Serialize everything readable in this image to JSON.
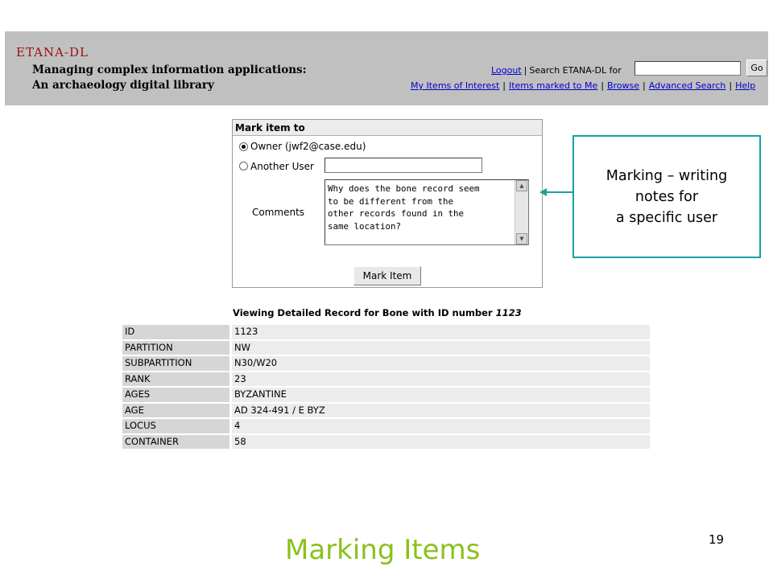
{
  "header": {
    "site_title": "ETANA-DL",
    "subtitle_line1": "Managing complex information applications:",
    "subtitle_line2": "An archaeology digital library",
    "logout_link": "Logout",
    "search_label": "Search ETANA-DL for",
    "search_value": "",
    "go_button": "Go",
    "nav": [
      "My Items of Interest",
      "Items marked to Me",
      "Browse",
      "Advanced Search",
      "Help"
    ]
  },
  "mark_form": {
    "heading": "Mark item to",
    "owner_option": "Owner (jwf2@case.edu)",
    "owner_checked": true,
    "another_user_option": "Another User",
    "another_user_checked": false,
    "another_user_value": "",
    "comments_label": "Comments",
    "comments_value": "Why does the bone record seem\nto be different from the\nother records found in the\nsame location?",
    "submit_button": "Mark Item"
  },
  "callout": {
    "line1": "Marking – writing",
    "line2": "notes for",
    "line3": "a specific user",
    "border_color": "#19a1a1"
  },
  "record": {
    "title_prefix": "Viewing Detailed Record for Bone with ID number",
    "title_id": "1123",
    "rows": [
      {
        "key": "ID",
        "value": "1123"
      },
      {
        "key": "PARTITION",
        "value": "NW"
      },
      {
        "key": "SUBPARTITION",
        "value": "N30/W20"
      },
      {
        "key": "RANK",
        "value": "23"
      },
      {
        "key": "AGES",
        "value": "BYZANTINE"
      },
      {
        "key": "AGE",
        "value": "AD 324-491 / E BYZ"
      },
      {
        "key": "LOCUS",
        "value": "4"
      },
      {
        "key": "CONTAINER",
        "value": "58"
      }
    ]
  },
  "slide": {
    "title": "Marking Items",
    "page_number": "19",
    "title_color": "#8ac11b"
  }
}
